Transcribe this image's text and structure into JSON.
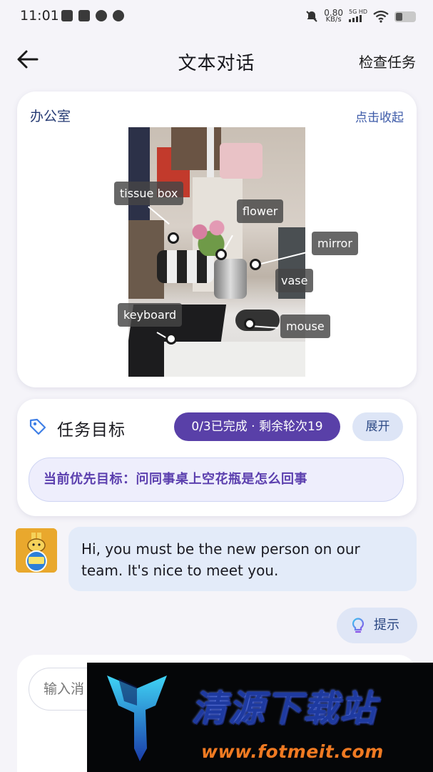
{
  "status_bar": {
    "time": "11:01",
    "net_speed_value": "0.80",
    "net_speed_unit": "KB/s",
    "signal_label": "5G HD",
    "icons": [
      "notification-app-icon",
      "mail-icon",
      "camera-app-icon",
      "chat-icon",
      "mute-icon",
      "signal-icon",
      "wifi-icon",
      "battery-icon"
    ]
  },
  "header": {
    "back_icon": "arrow-left-icon",
    "title": "文本对话",
    "check_task": "检查任务"
  },
  "scene": {
    "name": "办公室",
    "collapse": "点击收起",
    "labels": [
      "tissue box",
      "flower",
      "mirror",
      "vase",
      "keyboard",
      "mouse"
    ]
  },
  "task": {
    "icon": "tag-icon",
    "title": "任务目标",
    "progress": "0/3已完成 · 剩余轮次19",
    "expand": "展开",
    "current_goal": "当前优先目标：问同事桌上空花瓶是怎么回事"
  },
  "chat": {
    "avatar_icon": "giraffe-abc-avatar",
    "messages": [
      {
        "sender": "bot",
        "text": "Hi, you must be the new person on our team. It's nice to meet you."
      }
    ],
    "hint_icon": "lightbulb-icon",
    "hint": "提示"
  },
  "input": {
    "placeholder": "输入消"
  },
  "watermark": {
    "title": "清源下载站",
    "url": "www.fotmeit.com"
  },
  "colors": {
    "accent": "#5940a8",
    "link": "#3c5aa8",
    "bubble": "#e3ebf9",
    "page_bg": "#f5f4f9"
  }
}
